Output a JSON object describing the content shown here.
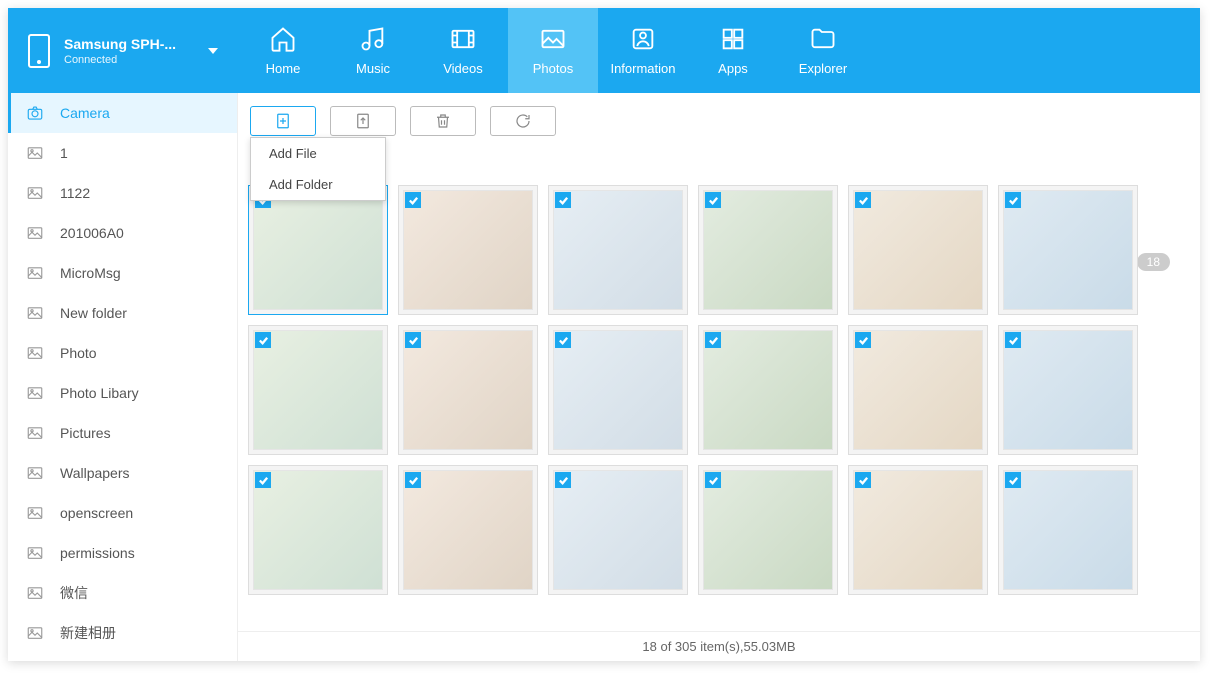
{
  "device": {
    "name": "Samsung SPH-...",
    "status": "Connected"
  },
  "nav": [
    {
      "label": "Home"
    },
    {
      "label": "Music"
    },
    {
      "label": "Videos"
    },
    {
      "label": "Photos",
      "active": true
    },
    {
      "label": "Information"
    },
    {
      "label": "Apps"
    },
    {
      "label": "Explorer"
    }
  ],
  "sidebar": [
    {
      "label": "Camera",
      "active": true,
      "icon": "camera"
    },
    {
      "label": "1"
    },
    {
      "label": "1122"
    },
    {
      "label": "201006A0"
    },
    {
      "label": "MicroMsg"
    },
    {
      "label": "New folder"
    },
    {
      "label": "Photo"
    },
    {
      "label": "Photo Libary"
    },
    {
      "label": "Pictures"
    },
    {
      "label": "Wallpapers"
    },
    {
      "label": "openscreen"
    },
    {
      "label": "permissions"
    },
    {
      "label": "微信"
    },
    {
      "label": "新建相册"
    }
  ],
  "dropdown": {
    "item1": "Add File",
    "item2": "Add Folder"
  },
  "badge": "18",
  "status": "18 of 305 item(s),55.03MB",
  "thumbs": 18
}
